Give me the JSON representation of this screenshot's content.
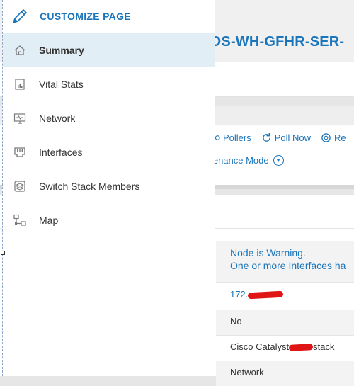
{
  "background": {
    "node_title": "HOS-WH-GFHR-SER-",
    "actions": {
      "pollers": "Pollers",
      "poll_now": "Poll Now",
      "rediscover": "Re"
    },
    "maintenance": "ntenance Mode",
    "details": {
      "status_line1": "Node is Warning.",
      "status_line2": "One or more Interfaces ha",
      "ip_address": "172.",
      "row2": "No",
      "machine_type": "Cisco Catalyst",
      "machine_type_suffix": "stack",
      "category": "Network"
    }
  },
  "flyout": {
    "customize_label": "CUSTOMIZE PAGE",
    "items": [
      {
        "label": "Summary",
        "icon": "home-icon",
        "active": true
      },
      {
        "label": "Vital Stats",
        "icon": "chart-icon",
        "active": false
      },
      {
        "label": "Network",
        "icon": "network-monitor-icon",
        "active": false
      },
      {
        "label": "Interfaces",
        "icon": "ethernet-port-icon",
        "active": false
      },
      {
        "label": "Switch Stack Members",
        "icon": "layers-icon",
        "active": false
      },
      {
        "label": "Map",
        "icon": "topology-map-icon",
        "active": false
      }
    ]
  },
  "colors": {
    "accent": "#1b75bb",
    "active_bg": "#e2eef6",
    "redaction": "#e01515"
  }
}
